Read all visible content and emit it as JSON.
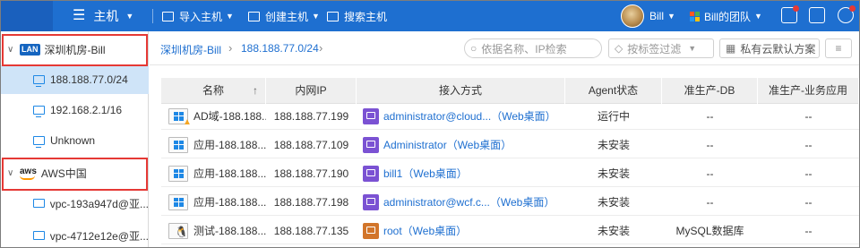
{
  "topbar": {
    "title": "主机",
    "import_label": "导入主机",
    "create_label": "创建主机",
    "search_label": "搜索主机",
    "user_name": "Bill",
    "team_label": "Bill的团队"
  },
  "sidebar": {
    "groups": [
      {
        "badge": "LAN",
        "label": "深圳机房-Bill"
      },
      {
        "badge": "aws",
        "label": "AWS中国"
      }
    ],
    "lan_items": [
      {
        "label": "188.188.77.0/24"
      },
      {
        "label": "192.168.2.1/16"
      },
      {
        "label": "Unknown"
      }
    ],
    "aws_items": [
      {
        "label": "vpc-193a947d@亚..."
      },
      {
        "label": "vpc-4712e12e@亚..."
      }
    ]
  },
  "breadcrumb": {
    "root": "深圳机房-Bill",
    "current": "188.188.77.0/24"
  },
  "toolbar": {
    "search_placeholder": "依据名称、IP检索",
    "tag_filter_label": "按标签过滤",
    "cloud_plan_label": "私有云默认方案"
  },
  "table": {
    "columns": [
      "名称",
      "内网IP",
      "接入方式",
      "Agent状态",
      "准生产-DB",
      "准生产-业务应用"
    ],
    "sort_indicator": "↑",
    "rows": [
      {
        "os": "windows",
        "warning": true,
        "name": "AD域-188.188...",
        "ip": "188.188.77.199",
        "access_type": "purple",
        "access": "administrator@cloud...（Web桌面）",
        "agent": "运行中",
        "db": "--",
        "app": "--"
      },
      {
        "os": "windows",
        "warning": false,
        "name": "应用-188.188...",
        "ip": "188.188.77.109",
        "access_type": "purple",
        "access": "Administrator（Web桌面）",
        "agent": "未安装",
        "db": "--",
        "app": "--"
      },
      {
        "os": "windows",
        "warning": false,
        "name": "应用-188.188...",
        "ip": "188.188.77.190",
        "access_type": "purple",
        "access": "bill1（Web桌面）",
        "agent": "未安装",
        "db": "--",
        "app": "--"
      },
      {
        "os": "windows",
        "warning": false,
        "name": "应用-188.188...",
        "ip": "188.188.77.198",
        "access_type": "purple",
        "access": "administrator@wcf.c...（Web桌面）",
        "agent": "未安装",
        "db": "--",
        "app": "--"
      },
      {
        "os": "linux",
        "warning": false,
        "name": "测试-188.188...",
        "ip": "188.188.77.135",
        "access_type": "orange",
        "access": "root（Web桌面）",
        "agent": "未安装",
        "db": "MySQL数据库",
        "app": "--"
      }
    ]
  },
  "colors": {
    "topbar": "#1e6fd0",
    "accent": "#1e6fd0",
    "selected_row": "#cfe4f8",
    "highlight_box": "#e53935"
  }
}
